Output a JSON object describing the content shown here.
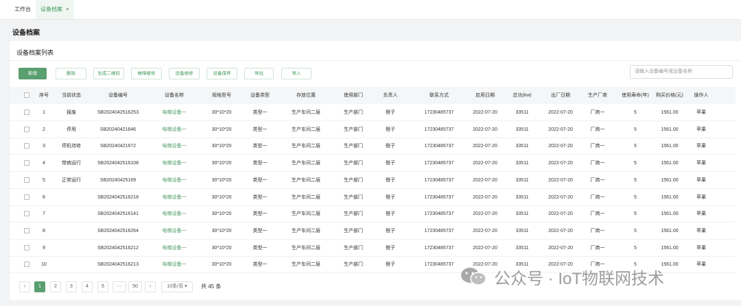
{
  "tabs": [
    {
      "label": "工作台",
      "active": false
    },
    {
      "label": "设备档案",
      "active": true,
      "close": "×"
    }
  ],
  "page_title": "设备档案",
  "card_title": "设备档案列表",
  "toolbar": {
    "add": "新增",
    "delete": "删除",
    "qr": "生成二维码",
    "fault": "故障报修",
    "repair": "设备维修",
    "maintain": "设备保养",
    "export": "导出",
    "import": "导入"
  },
  "search": {
    "placeholder": "请输入设备编号或设备名称"
  },
  "columns": [
    "序号",
    "当前状态",
    "设备编号",
    "设备名称",
    "规格型号",
    "设备类型",
    "存放位置",
    "使用部门",
    "负责人",
    "联系方式",
    "启用日期",
    "总功(kw)",
    "出厂日期",
    "生产厂商",
    "使用寿命(年)",
    "购买价格(元)",
    "操作人"
  ],
  "rows": [
    [
      "1",
      "报废",
      "SB2024042516253",
      "电梯设备一",
      "30*10*20",
      "类型一",
      "生产车间二层",
      "生产部门",
      "橙子",
      "17230485737",
      "2022-07-20",
      "33511",
      "2022-07-20",
      "厂商一",
      "5",
      "1561.00",
      "苹果"
    ],
    [
      "2",
      "停用",
      "SB20240421646",
      "电梯设备一",
      "30*10*20",
      "类型一",
      "生产车间二层",
      "生产部门",
      "橙子",
      "17230485737",
      "2022-07-20",
      "33511",
      "2022-07-20",
      "厂商一",
      "5",
      "1561.00",
      "苹果"
    ],
    [
      "3",
      "停机待修",
      "SB20240421672",
      "电梯设备一",
      "30*10*20",
      "类型一",
      "生产车间二层",
      "生产部门",
      "橙子",
      "17230485737",
      "2022-07-20",
      "33511",
      "2022-07-20",
      "厂商一",
      "5",
      "1561.00",
      "苹果"
    ],
    [
      "4",
      "带病运行",
      "SB2024042516108",
      "电梯设备一",
      "30*10*20",
      "类型一",
      "生产车间二层",
      "生产部门",
      "橙子",
      "17230485737",
      "2022-07-20",
      "33511",
      "2022-07-20",
      "厂商一",
      "5",
      "1561.00",
      "苹果"
    ],
    [
      "5",
      "正常运行",
      "SB20240425169",
      "电梯设备一",
      "30*10*20",
      "类型一",
      "生产车间二层",
      "生产部门",
      "橙子",
      "17230485737",
      "2022-07-20",
      "33511",
      "2022-07-20",
      "厂商一",
      "5",
      "1561.00",
      "苹果"
    ],
    [
      "6",
      "",
      "SB2024042516218",
      "电梯设备一",
      "30*10*20",
      "类型一",
      "生产车间二层",
      "生产部门",
      "橙子",
      "17230485737",
      "2022-07-20",
      "33511",
      "2022-07-20",
      "厂商一",
      "5",
      "1561.00",
      "苹果"
    ],
    [
      "7",
      "",
      "SB2024042516141",
      "电梯设备一",
      "30*10*20",
      "类型一",
      "生产车间二层",
      "生产部门",
      "橙子",
      "17230485737",
      "2022-07-20",
      "33511",
      "2022-07-20",
      "厂商一",
      "5",
      "1561.00",
      "苹果"
    ],
    [
      "8",
      "",
      "SB2024042516264",
      "电梯设备一",
      "30*10*20",
      "类型一",
      "生产车间二层",
      "生产部门",
      "橙子",
      "17230485737",
      "2022-07-20",
      "33511",
      "2022-07-20",
      "厂商一",
      "5",
      "1561.00",
      "苹果"
    ],
    [
      "9",
      "",
      "SB2024042516212",
      "电梯设备一",
      "30*10*20",
      "类型一",
      "生产车间二层",
      "生产部门",
      "橙子",
      "17230485737",
      "2022-07-20",
      "33511",
      "2022-07-20",
      "厂商一",
      "5",
      "1561.00",
      "苹果"
    ],
    [
      "10",
      "",
      "SB2024042516213",
      "电梯设备一",
      "30*10*20",
      "类型一",
      "生产车间二层",
      "生产部门",
      "橙子",
      "17230485737",
      "2022-07-20",
      "33511",
      "2022-07-20",
      "厂商一",
      "5",
      "1561.00",
      "苹果"
    ]
  ],
  "pagination": {
    "prev": "‹",
    "pages": [
      "1",
      "2",
      "3",
      "4",
      "5",
      "···",
      "50"
    ],
    "next": "›",
    "page_size": "10条/页 ▾",
    "total": "共 45 条"
  },
  "watermark": {
    "text": "公众号 · IoT物联网技术",
    "icon": "wechat-icon"
  },
  "colors": {
    "accent": "#5a9f70",
    "link": "#4c9a63"
  }
}
